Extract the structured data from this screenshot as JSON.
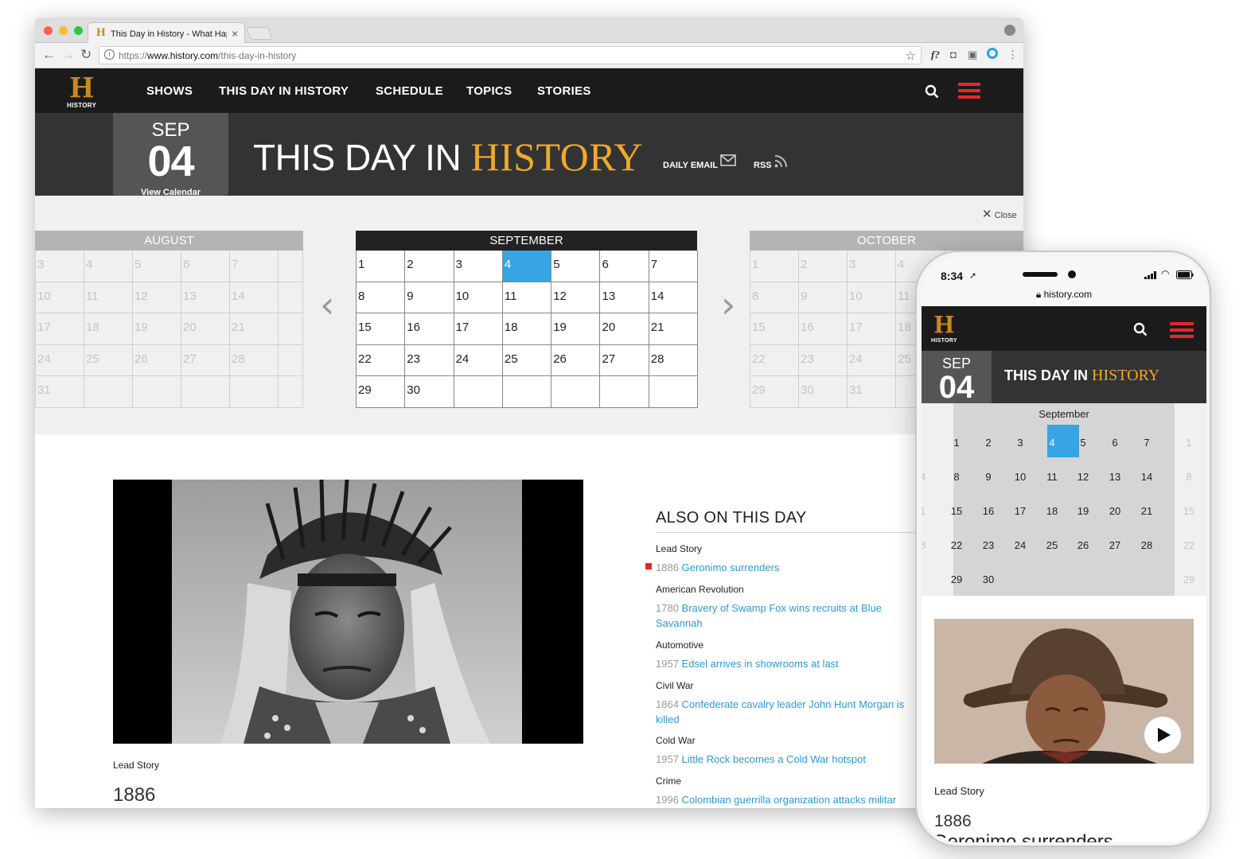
{
  "browser": {
    "tab_title": "This Day in History - What Hap",
    "url_scheme": "https://",
    "url_domain": "www.history.com",
    "url_path": "/this-day-in-history"
  },
  "site": {
    "logo_letter": "H",
    "logo_text": "HISTORY",
    "nav": [
      "SHOWS",
      "THIS DAY IN HISTORY",
      "SCHEDULE",
      "TOPICS",
      "STORIES"
    ],
    "date_month": "SEP",
    "date_day": "04",
    "view_calendar": "View Calendar",
    "banner_title_a": "THIS DAY IN ",
    "banner_title_b": "HISTORY",
    "daily_email": "DAILY EMAIL",
    "rss": "RSS",
    "close_label": "Close",
    "calendar": {
      "prev": {
        "name": "AUGUST",
        "rows": [
          [
            "3",
            "4",
            "5",
            "6",
            "7"
          ],
          [
            "10",
            "11",
            "12",
            "13",
            "14"
          ],
          [
            "17",
            "18",
            "19",
            "20",
            "21"
          ],
          [
            "24",
            "25",
            "26",
            "27",
            "28"
          ],
          [
            "31",
            "",
            "",
            "",
            ""
          ]
        ]
      },
      "current": {
        "name": "SEPTEMBER",
        "today": "4",
        "rows": [
          [
            "1",
            "2",
            "3",
            "4",
            "5",
            "6",
            "7"
          ],
          [
            "8",
            "9",
            "10",
            "11",
            "12",
            "13",
            "14"
          ],
          [
            "15",
            "16",
            "17",
            "18",
            "19",
            "20",
            "21"
          ],
          [
            "22",
            "23",
            "24",
            "25",
            "26",
            "27",
            "28"
          ],
          [
            "29",
            "30",
            "",
            "",
            "",
            "",
            ""
          ]
        ]
      },
      "next": {
        "name": "OCTOBER",
        "rows": [
          [
            "1",
            "2",
            "3",
            "4"
          ],
          [
            "8",
            "9",
            "10",
            "11"
          ],
          [
            "15",
            "16",
            "17",
            "18"
          ],
          [
            "22",
            "23",
            "24",
            "25"
          ],
          [
            "29",
            "30",
            "31",
            ""
          ]
        ]
      }
    },
    "lead_story_label": "Lead Story",
    "lead_story_year": "1886",
    "also_title": "ALSO ON THIS DAY",
    "also_events": [
      {
        "category": "Lead Story",
        "year": "1886",
        "title": "Geronimo surrenders"
      },
      {
        "category": "American Revolution",
        "year": "1780",
        "title": "Bravery of Swamp Fox wins recruits at Blue Savannah"
      },
      {
        "category": "Automotive",
        "year": "1957",
        "title": "Edsel arrives in showrooms at last"
      },
      {
        "category": "Civil War",
        "year": "1864",
        "title": "Confederate cavalry leader John Hunt Morgan is killed"
      },
      {
        "category": "Cold War",
        "year": "1957",
        "title": "Little Rock becomes a Cold War hotspot"
      },
      {
        "category": "Crime",
        "year": "1996",
        "title": "Colombian guerrilla organization attacks militar"
      }
    ]
  },
  "phone": {
    "time": "8:34",
    "url": "history.com",
    "month_label": "September",
    "title_a": "THIS DAY IN ",
    "title_b": "HISTORY",
    "date_month": "SEP",
    "date_day": "04",
    "cal_rows": [
      [
        "1",
        "2",
        "3",
        "4",
        "5",
        "6",
        "7"
      ],
      [
        "8",
        "9",
        "10",
        "11",
        "12",
        "13",
        "14"
      ],
      [
        "15",
        "16",
        "17",
        "18",
        "19",
        "20",
        "21"
      ],
      [
        "22",
        "23",
        "24",
        "25",
        "26",
        "27",
        "28"
      ],
      [
        "29",
        "30",
        "",
        "",
        "",
        "",
        ""
      ]
    ],
    "ghost_left": [
      "",
      "4",
      "1",
      "8",
      ""
    ],
    "ghost_right": [
      "1",
      "8",
      "15",
      "22",
      "29"
    ],
    "lead_label": "Lead Story",
    "lead_year": "1886",
    "headline": "Geronimo surrenders"
  },
  "colors": {
    "accent_gold": "#f0a929",
    "today_blue": "#37a4e3",
    "link_blue": "#2b9ad8",
    "menu_red": "#e4272e"
  }
}
